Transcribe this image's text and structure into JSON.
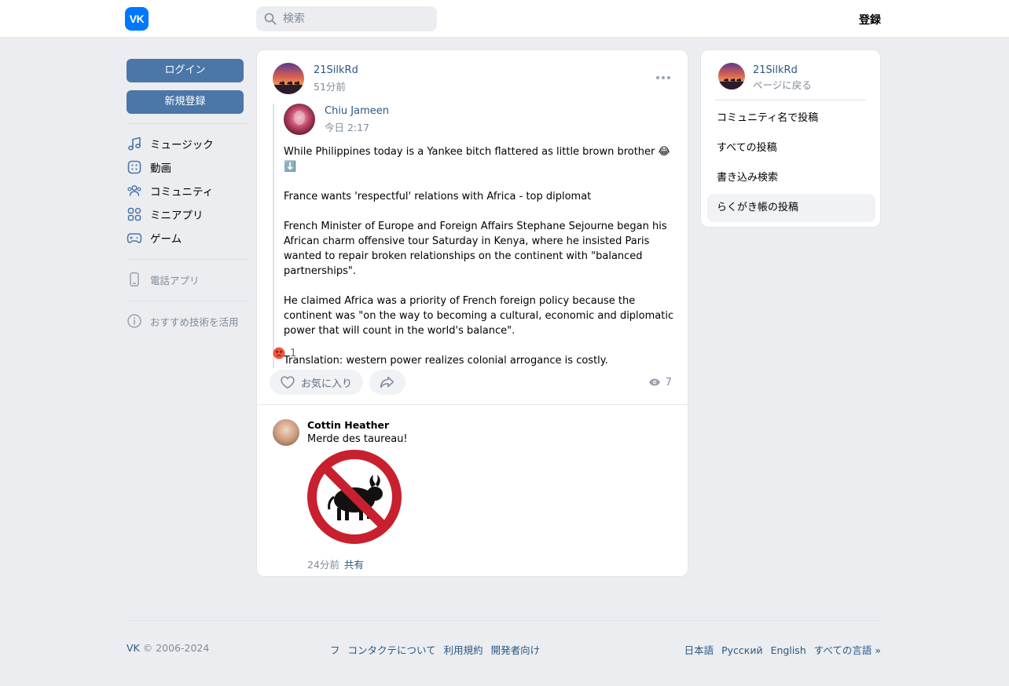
{
  "header": {
    "logo_text": "VK",
    "search_placeholder": "検索",
    "register_label": "登録"
  },
  "sidebar": {
    "login_label": "ログイン",
    "signup_label": "新規登録",
    "nav": [
      {
        "label": "ミュージック",
        "icon": "music-icon"
      },
      {
        "label": "動画",
        "icon": "video-icon"
      },
      {
        "label": "コミュニティ",
        "icon": "community-icon"
      },
      {
        "label": "ミニアプリ",
        "icon": "apps-icon"
      },
      {
        "label": "ゲーム",
        "icon": "gamepad-icon"
      }
    ],
    "phone_app_label": "電話アプリ",
    "recommend_label": "おすすめ技術を活用"
  },
  "post": {
    "author": "21SilkRd",
    "time": "51分前",
    "repost": {
      "author": "Chiu Jameen",
      "time": "今日 2:17",
      "text": "While Philippines today is a Yankee bitch flattered as little brown brother 😂 ⬇️\n\nFrance wants 'respectful' relations with Africa - top diplomat\n\nFrench Minister of Europe and Foreign Affairs Stephane Sejourne began his African charm offensive tour Saturday in Kenya, where he insisted Paris wanted to repair broken relationships on the continent with \"balanced partnerships\".\n\nHe claimed Africa was a priority of French foreign policy because the continent was \"on the way to becoming a cultural, economic and diplomatic power that will count in the world's balance\".\n\nTranslation: western power realizes colonial arrogance is costly."
    },
    "reaction_count": "1",
    "like_label": "お気に入り",
    "views": "7"
  },
  "comment": {
    "author": "Cottin Heather",
    "text": "Merde des taureau!",
    "time": "24分前",
    "share_label": "共有"
  },
  "right_panel": {
    "name": "21SilkRd",
    "back_label": "ページに戻る",
    "items": [
      "コミュニティ名で投稿",
      "すべての投稿",
      "書き込み検索",
      "らくがき帳の投稿"
    ]
  },
  "footer": {
    "copyright_vk": "VK",
    "copyright_rest": " © 2006-2024",
    "links": [
      "フ",
      "コンタクテについて",
      "利用規約",
      "開発者向け"
    ],
    "languages": [
      "日本語",
      "Русский",
      "English",
      "すべての言語 »"
    ]
  },
  "colors": {
    "accent": "#4a76a8",
    "link": "#2a5885",
    "brand": "#0077ff",
    "background": "#ebedf0"
  }
}
